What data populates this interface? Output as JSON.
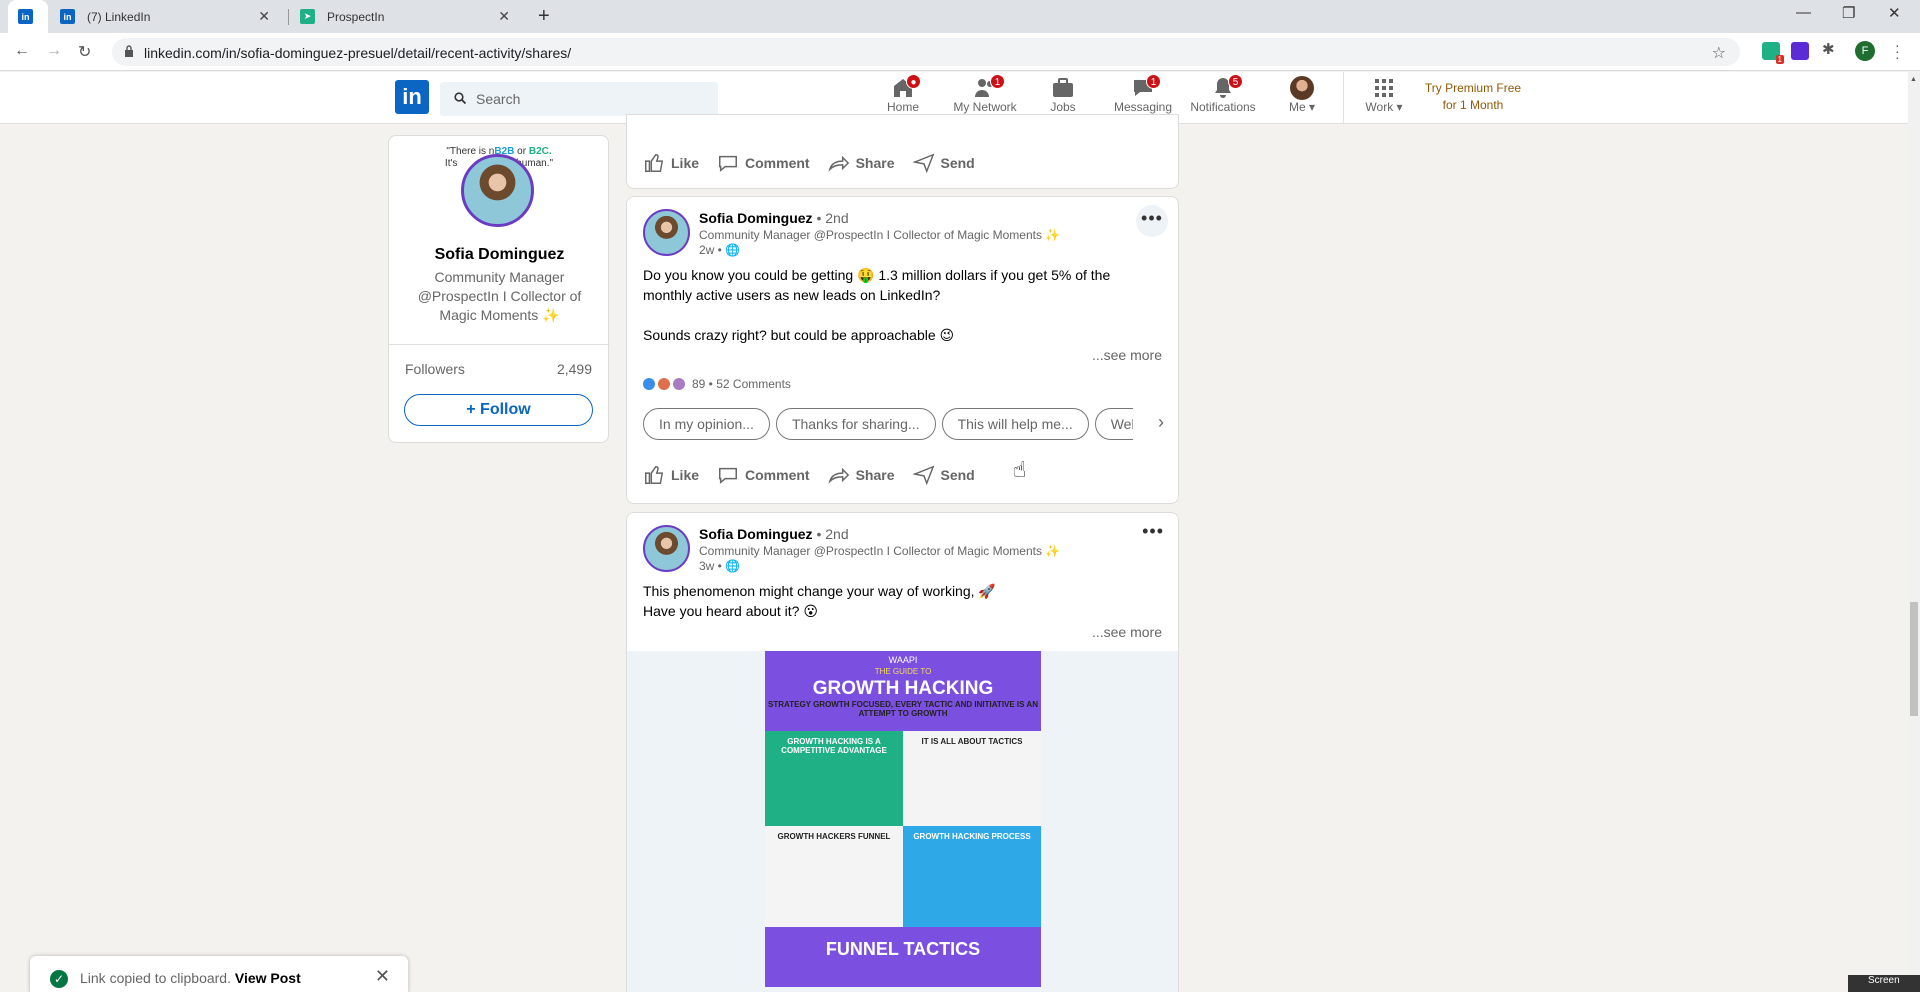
{
  "browser": {
    "tabs": [
      {
        "title": "",
        "icon": "linkedin-icon"
      },
      {
        "title": "(7) LinkedIn",
        "icon": "linkedin-icon"
      },
      {
        "title": "ProspectIn",
        "icon": "prospectin-icon"
      }
    ],
    "url": "linkedin.com/in/sofia-dominguez-presuel/detail/recent-activity/shares/",
    "profile_initial": "F",
    "ext_badge": "1"
  },
  "header": {
    "logo": "in",
    "search_placeholder": "Search",
    "nav": [
      {
        "label": "Home",
        "badge": ""
      },
      {
        "label": "My Network",
        "badge": "1"
      },
      {
        "label": "Jobs",
        "badge": ""
      },
      {
        "label": "Messaging",
        "badge": "1"
      },
      {
        "label": "Notifications",
        "badge": "5"
      },
      {
        "label": "Me",
        "badge": ""
      },
      {
        "label": "Work",
        "badge": ""
      }
    ],
    "premium_line1": "Try Premium Free",
    "premium_line2": "for 1 Month"
  },
  "profile": {
    "banner_quote_1": "\"There is n",
    "banner_quote_b2b": "B2B",
    "banner_quote_or": " or ",
    "banner_quote_b2c": "B2C.",
    "banner_quote_2": "It's",
    "banner_quote_3": "human.\"",
    "name": "Sofia Dominguez",
    "title": "Community Manager @ProspectIn I Collector of Magic Moments ✨",
    "followers_label": "Followers",
    "followers_count": "2,499",
    "follow_label": "+ Follow"
  },
  "actions": {
    "like": "Like",
    "comment": "Comment",
    "share": "Share",
    "send": "Send"
  },
  "posts": [
    {
      "author": "Sofia Dominguez",
      "degree": " • 2nd",
      "headline": "Community Manager @ProspectIn I Collector of Magic Moments ✨",
      "time": "2w •",
      "body_1": "Do you know you could be getting 🤑 1.3 million dollars if you get 5% of the monthly active users as new leads on LinkedIn?",
      "body_2": "Sounds crazy right? but could be approachable 😉",
      "see_more": "...see more",
      "reactions": "89 • 52 Comments",
      "chips": [
        "In my opinion...",
        "Thanks for sharing...",
        "This will help me...",
        "Wel"
      ]
    },
    {
      "author": "Sofia Dominguez",
      "degree": " • 2nd",
      "headline": "Community Manager @ProspectIn I Collector of Magic Moments ✨",
      "time": "3w •",
      "body_1": "This phenomenon might change your way of working, 🚀",
      "body_2": "Have you heard about it? 😮",
      "see_more": "...see more",
      "image": {
        "brand": "WAAPI",
        "guide": "THE GUIDE TO",
        "title": "GROWTH HACKING",
        "subtitle": "STRATEGY GROWTH FOCUSED, EVERY TACTIC AND INITIATIVE IS AN ATTEMPT TO GROWTH",
        "cell1": "GROWTH HACKING IS A COMPETITIVE ADVANTAGE",
        "cell2": "IT IS ALL ABOUT TACTICS",
        "cell3": "GROWTH HACKERS FUNNEL",
        "cell4": "GROWTH HACKING PROCESS",
        "bottom": "FUNNEL TACTICS"
      }
    }
  ],
  "toast": {
    "message": "Link copied to clipboard. ",
    "link": "View Post"
  },
  "taskbar_label": "Screen"
}
